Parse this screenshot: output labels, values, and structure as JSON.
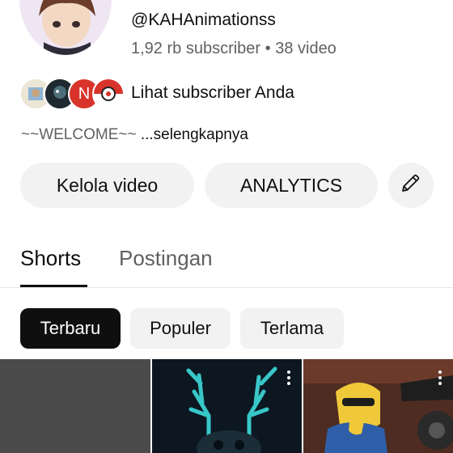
{
  "channel": {
    "handle": "@KAHAnimationss",
    "meta": "1,92 rb subscriber • 38 video",
    "subscribers_link": "Lihat subscriber Anda",
    "subscriber_avatar_letter": "N",
    "description": "~~WELCOME~~",
    "more_label": "...selengkapnya"
  },
  "actions": {
    "manage_videos": "Kelola video",
    "analytics": "ANALYTICS",
    "edit_icon": "pencil-icon"
  },
  "tabs": [
    {
      "label": "Shorts",
      "active": true
    },
    {
      "label": "Postingan",
      "active": false
    }
  ],
  "sort_chips": [
    {
      "label": "Terbaru",
      "selected": true
    },
    {
      "label": "Populer",
      "selected": false
    },
    {
      "label": "Terlama",
      "selected": false
    }
  ],
  "colors": {
    "text_primary": "#0f0f0f",
    "text_secondary": "#606060",
    "chip_bg": "#f2f2f2",
    "chip_selected_bg": "#0f0f0f",
    "subscriber_red": "#d9342b"
  }
}
